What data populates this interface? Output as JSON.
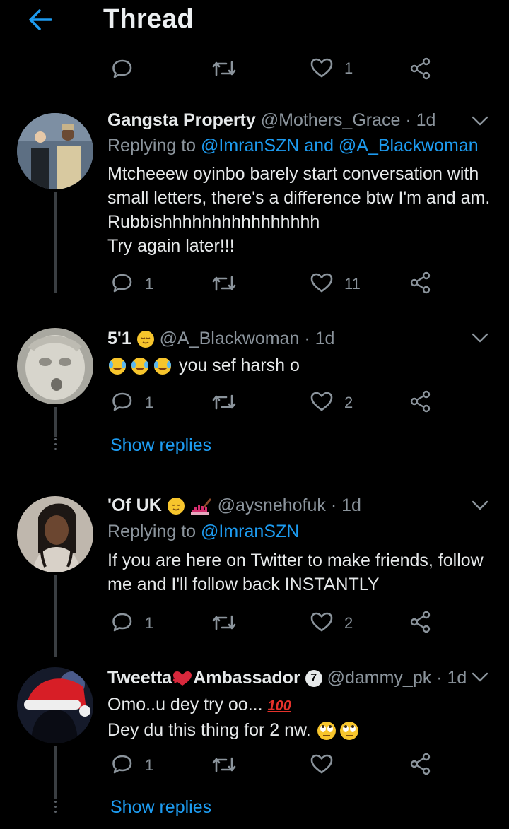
{
  "header": {
    "title": "Thread"
  },
  "top_actions": {
    "like_count": "1"
  },
  "tweets": [
    {
      "name": "Gangsta Property",
      "handle": "@Mothers_Grace",
      "time": "· 1d",
      "replying_prefix": "Replying to",
      "replying_to": "@ImranSZN and @A_Blackwoman",
      "lines": [
        "Mtcheeew oyinbo barely start conversation with",
        "small letters, there's a difference btw I'm and am.",
        "Rubbishhhhhhhhhhhhhhhh",
        "Try again later!!!"
      ],
      "reply_count": "1",
      "like_count": "11"
    },
    {
      "name": "5'1",
      "handle": "@A_Blackwoman",
      "time": "· 1d",
      "text": "you sef harsh o",
      "reply_count": "1",
      "like_count": "2",
      "show_replies": "Show replies"
    },
    {
      "name": "'Of UK",
      "handle": "@aysnehofuk",
      "time": "· 1d",
      "replying_prefix": "Replying to",
      "replying_to": "@ImranSZN",
      "lines": [
        "If you are here on Twitter to make friends, follow",
        "me and I'll follow back INSTANTLY"
      ],
      "reply_count": "1",
      "like_count": "2"
    },
    {
      "name_part1": "Tweetta",
      "name_part2": "Ambassador",
      "badge": "7",
      "handle": "@dammy_pk",
      "time": "· 1d",
      "line1": "Omo..u dey try oo...",
      "hundred": "100",
      "line2": "Dey du this thing for 2 nw.",
      "reply_count": "1",
      "show_replies": "Show replies"
    }
  ],
  "colors": {
    "background": "#000000",
    "accent": "#1d9bf0",
    "muted": "#8b949c",
    "divider": "#2a2d30"
  }
}
